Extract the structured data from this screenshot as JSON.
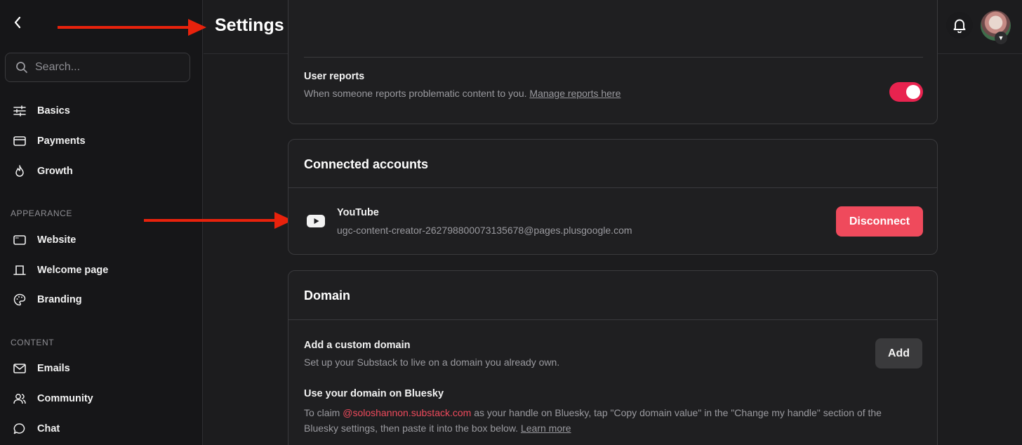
{
  "sidebar": {
    "search_placeholder": "Search...",
    "items": [
      {
        "label": "Basics",
        "icon": "sliders-icon"
      },
      {
        "label": "Payments",
        "icon": "credit-card-icon"
      },
      {
        "label": "Growth",
        "icon": "flame-icon"
      }
    ],
    "appearance": {
      "section_label": "APPEARANCE",
      "items": [
        {
          "label": "Website",
          "icon": "browser-window-icon"
        },
        {
          "label": "Welcome page",
          "icon": "welcome-page-icon"
        },
        {
          "label": "Branding",
          "icon": "palette-icon"
        }
      ]
    },
    "content": {
      "section_label": "CONTENT",
      "items": [
        {
          "label": "Emails",
          "icon": "envelope-icon"
        },
        {
          "label": "Community",
          "icon": "people-icon"
        },
        {
          "label": "Chat",
          "icon": "chat-bubble-icon"
        }
      ]
    }
  },
  "header": {
    "title": "Settings",
    "icons": [
      "search-icon",
      "chat-bubble-icon",
      "bell-icon"
    ]
  },
  "user_reports": {
    "title": "User reports",
    "description": "When someone reports problematic content to you.",
    "link": "Manage reports here",
    "toggle_on": true
  },
  "connected_accounts": {
    "title": "Connected accounts",
    "account": {
      "name": "YouTube",
      "email": "ugc-content-creator-262798800073135678@pages.plusgoogle.com",
      "button": "Disconnect"
    }
  },
  "domain": {
    "title": "Domain",
    "custom_domain": {
      "title": "Add a custom domain",
      "description": "Set up your Substack to live on a domain you already own.",
      "button": "Add"
    },
    "bluesky": {
      "title": "Use your domain on Bluesky",
      "desc_part1": "To claim ",
      "handle": "@soloshannon.substack.com",
      "desc_part2": " as your handle on Bluesky, tap \"Copy domain value\" in the \"Change my handle\" section of the",
      "desc_part3": "Bluesky settings, then paste it into the box below.",
      "learn_more": "Learn more"
    }
  },
  "colors": {
    "accent": "#ef4a5c",
    "toggle_on": "#e8234f",
    "annotation_arrow": "#e8220c"
  }
}
